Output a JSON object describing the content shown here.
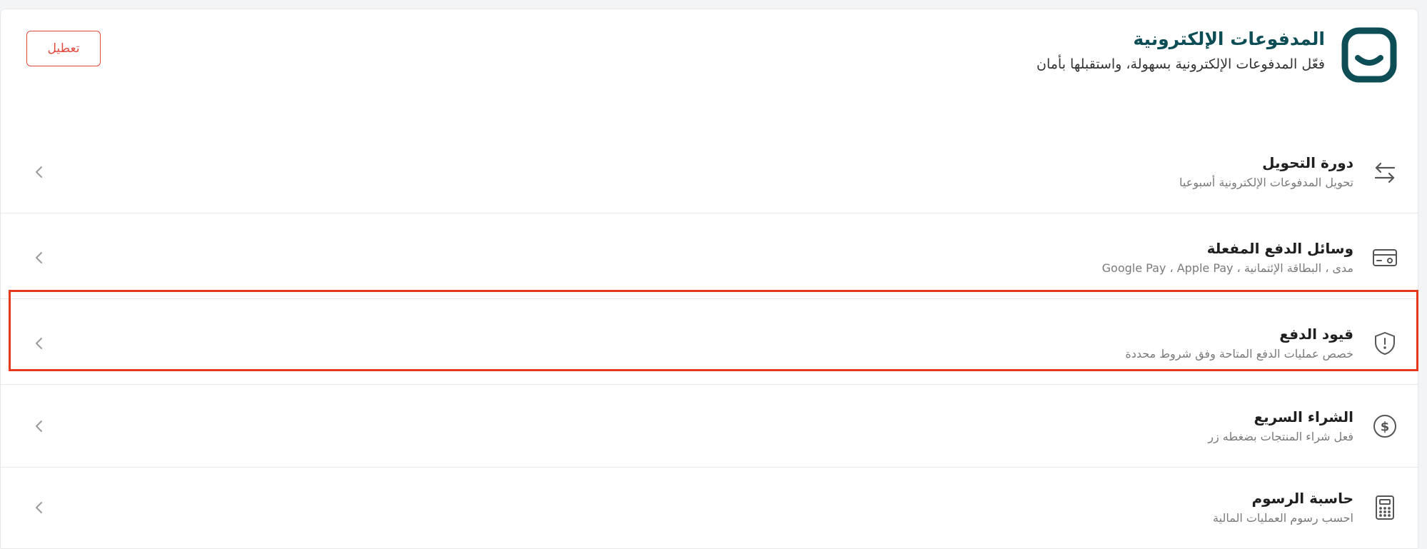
{
  "header": {
    "title": "المدفوعات الإلكترونية",
    "subtitle": "فعّل المدفوعات الإلكترونية بسهولة، واستقبلها بأمان",
    "disable_label": "تعطيل"
  },
  "rows": [
    {
      "title": "دورة التحويل",
      "subtitle": "تحويل المدفوعات الإلكترونية أسبوعيا",
      "icon": "transfer-arrows-icon"
    },
    {
      "title": "وسائل الدفع المفعلة",
      "subtitle": "مدى ، البطاقة الإئتمانية ، Google Pay ، Apple Pay",
      "icon": "card-icon"
    },
    {
      "title": "قيود الدفع",
      "subtitle": "خصص عمليات الدفع المتاحة وفق شروط محددة",
      "icon": "shield-alert-icon"
    },
    {
      "title": "الشراء السريع",
      "subtitle": "فعل شراء المنتجات بضغطه زر",
      "icon": "dollar-circle-icon"
    },
    {
      "title": "حاسبة الرسوم",
      "subtitle": "احسب رسوم العمليات المالية",
      "icon": "calculator-icon"
    }
  ],
  "colors": {
    "brand": "#0c4d56",
    "danger": "#e34a3f",
    "highlight": "#e4391c"
  }
}
